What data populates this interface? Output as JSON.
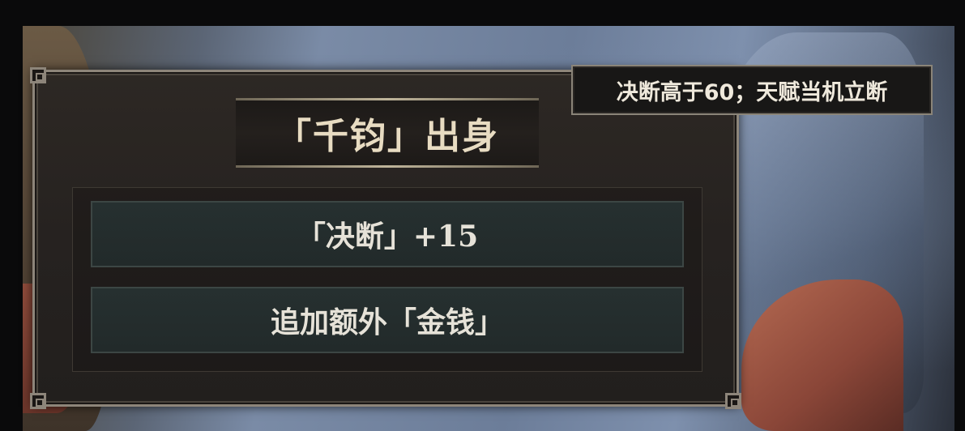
{
  "panel": {
    "title": "「千钧」出身",
    "options": [
      {
        "label": "「决断」+15"
      },
      {
        "label": "追加额外「金钱」"
      }
    ]
  },
  "tooltip": {
    "text": "决断高于60；天赋当机立断"
  },
  "colors": {
    "panel_border": "#8d857a",
    "title_text": "#e8dcc2",
    "option_bg": "#263030",
    "tooltip_bg": "#181716"
  }
}
